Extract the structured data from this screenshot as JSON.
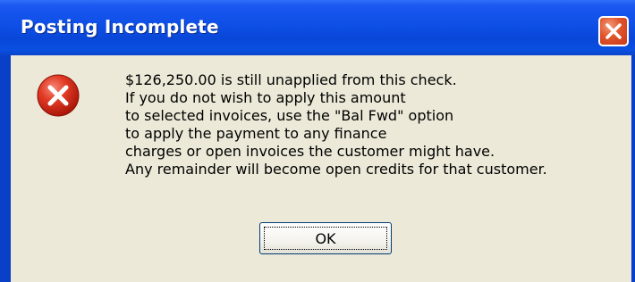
{
  "window": {
    "title": "Posting Incomplete",
    "close_icon": "close-icon"
  },
  "dialog": {
    "icon": "error-icon",
    "message_lines": [
      "$126,250.00 is still unapplied from this check.",
      "If you do not wish to apply this amount",
      "to selected invoices, use the \"Bal Fwd\" option",
      "to apply the payment to any finance",
      "charges or open invoices the customer might have.",
      "Any remainder will become open credits for that customer."
    ],
    "ok_label": "OK"
  },
  "colors": {
    "titlebar": "#0a4fe0",
    "close_button": "#e0532a",
    "dialog_background": "#ece9d8",
    "error_icon": "#d8301f"
  }
}
